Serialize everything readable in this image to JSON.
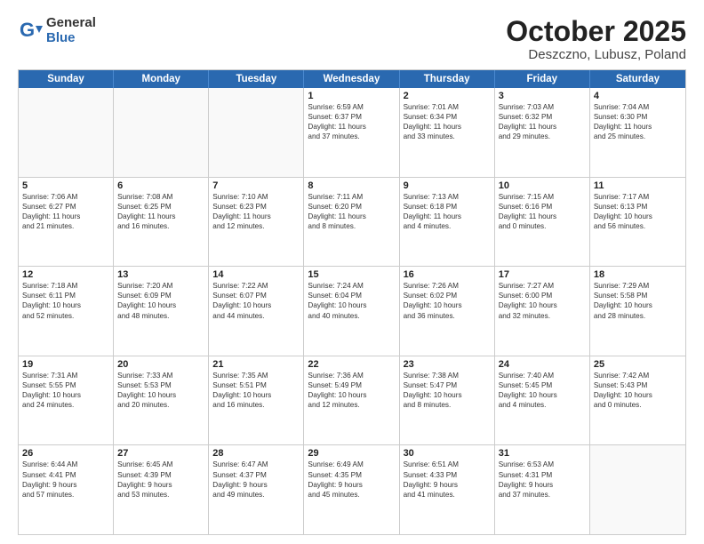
{
  "logo": {
    "general": "General",
    "blue": "Blue"
  },
  "title": "October 2025",
  "subtitle": "Deszczno, Lubusz, Poland",
  "headers": [
    "Sunday",
    "Monday",
    "Tuesday",
    "Wednesday",
    "Thursday",
    "Friday",
    "Saturday"
  ],
  "weeks": [
    [
      {
        "day": "",
        "info": ""
      },
      {
        "day": "",
        "info": ""
      },
      {
        "day": "",
        "info": ""
      },
      {
        "day": "1",
        "info": "Sunrise: 6:59 AM\nSunset: 6:37 PM\nDaylight: 11 hours\nand 37 minutes."
      },
      {
        "day": "2",
        "info": "Sunrise: 7:01 AM\nSunset: 6:34 PM\nDaylight: 11 hours\nand 33 minutes."
      },
      {
        "day": "3",
        "info": "Sunrise: 7:03 AM\nSunset: 6:32 PM\nDaylight: 11 hours\nand 29 minutes."
      },
      {
        "day": "4",
        "info": "Sunrise: 7:04 AM\nSunset: 6:30 PM\nDaylight: 11 hours\nand 25 minutes."
      }
    ],
    [
      {
        "day": "5",
        "info": "Sunrise: 7:06 AM\nSunset: 6:27 PM\nDaylight: 11 hours\nand 21 minutes."
      },
      {
        "day": "6",
        "info": "Sunrise: 7:08 AM\nSunset: 6:25 PM\nDaylight: 11 hours\nand 16 minutes."
      },
      {
        "day": "7",
        "info": "Sunrise: 7:10 AM\nSunset: 6:23 PM\nDaylight: 11 hours\nand 12 minutes."
      },
      {
        "day": "8",
        "info": "Sunrise: 7:11 AM\nSunset: 6:20 PM\nDaylight: 11 hours\nand 8 minutes."
      },
      {
        "day": "9",
        "info": "Sunrise: 7:13 AM\nSunset: 6:18 PM\nDaylight: 11 hours\nand 4 minutes."
      },
      {
        "day": "10",
        "info": "Sunrise: 7:15 AM\nSunset: 6:16 PM\nDaylight: 11 hours\nand 0 minutes."
      },
      {
        "day": "11",
        "info": "Sunrise: 7:17 AM\nSunset: 6:13 PM\nDaylight: 10 hours\nand 56 minutes."
      }
    ],
    [
      {
        "day": "12",
        "info": "Sunrise: 7:18 AM\nSunset: 6:11 PM\nDaylight: 10 hours\nand 52 minutes."
      },
      {
        "day": "13",
        "info": "Sunrise: 7:20 AM\nSunset: 6:09 PM\nDaylight: 10 hours\nand 48 minutes."
      },
      {
        "day": "14",
        "info": "Sunrise: 7:22 AM\nSunset: 6:07 PM\nDaylight: 10 hours\nand 44 minutes."
      },
      {
        "day": "15",
        "info": "Sunrise: 7:24 AM\nSunset: 6:04 PM\nDaylight: 10 hours\nand 40 minutes."
      },
      {
        "day": "16",
        "info": "Sunrise: 7:26 AM\nSunset: 6:02 PM\nDaylight: 10 hours\nand 36 minutes."
      },
      {
        "day": "17",
        "info": "Sunrise: 7:27 AM\nSunset: 6:00 PM\nDaylight: 10 hours\nand 32 minutes."
      },
      {
        "day": "18",
        "info": "Sunrise: 7:29 AM\nSunset: 5:58 PM\nDaylight: 10 hours\nand 28 minutes."
      }
    ],
    [
      {
        "day": "19",
        "info": "Sunrise: 7:31 AM\nSunset: 5:55 PM\nDaylight: 10 hours\nand 24 minutes."
      },
      {
        "day": "20",
        "info": "Sunrise: 7:33 AM\nSunset: 5:53 PM\nDaylight: 10 hours\nand 20 minutes."
      },
      {
        "day": "21",
        "info": "Sunrise: 7:35 AM\nSunset: 5:51 PM\nDaylight: 10 hours\nand 16 minutes."
      },
      {
        "day": "22",
        "info": "Sunrise: 7:36 AM\nSunset: 5:49 PM\nDaylight: 10 hours\nand 12 minutes."
      },
      {
        "day": "23",
        "info": "Sunrise: 7:38 AM\nSunset: 5:47 PM\nDaylight: 10 hours\nand 8 minutes."
      },
      {
        "day": "24",
        "info": "Sunrise: 7:40 AM\nSunset: 5:45 PM\nDaylight: 10 hours\nand 4 minutes."
      },
      {
        "day": "25",
        "info": "Sunrise: 7:42 AM\nSunset: 5:43 PM\nDaylight: 10 hours\nand 0 minutes."
      }
    ],
    [
      {
        "day": "26",
        "info": "Sunrise: 6:44 AM\nSunset: 4:41 PM\nDaylight: 9 hours\nand 57 minutes."
      },
      {
        "day": "27",
        "info": "Sunrise: 6:45 AM\nSunset: 4:39 PM\nDaylight: 9 hours\nand 53 minutes."
      },
      {
        "day": "28",
        "info": "Sunrise: 6:47 AM\nSunset: 4:37 PM\nDaylight: 9 hours\nand 49 minutes."
      },
      {
        "day": "29",
        "info": "Sunrise: 6:49 AM\nSunset: 4:35 PM\nDaylight: 9 hours\nand 45 minutes."
      },
      {
        "day": "30",
        "info": "Sunrise: 6:51 AM\nSunset: 4:33 PM\nDaylight: 9 hours\nand 41 minutes."
      },
      {
        "day": "31",
        "info": "Sunrise: 6:53 AM\nSunset: 4:31 PM\nDaylight: 9 hours\nand 37 minutes."
      },
      {
        "day": "",
        "info": ""
      }
    ]
  ]
}
